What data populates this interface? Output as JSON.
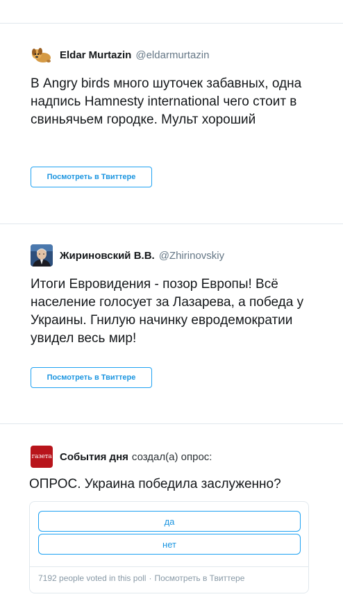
{
  "tweets": [
    {
      "name": "Eldar Murtazin",
      "handle": "@eldarmurtazin",
      "text": "В Angry birds много шуточек забавных, одна надпись Hamnesty international чего стоит в свиньячьем городке. Мульт хороший",
      "button": "Посмотреть в Твиттере",
      "avatar_icon": "cartoon-dog-avatar"
    },
    {
      "name": "Жириновский В.В.",
      "handle": "@Zhirinovskiy",
      "text": "Итоги Евровидения - позор Европы! Всё население голосует за Лазарева, а победа у Украины. Гнилую начинку еврoдемократии увидел весь мир!",
      "button": "Посмотреть в Твиттере",
      "avatar_icon": "portrait-avatar"
    }
  ],
  "poll": {
    "name": "События дня",
    "action": "создал(а) опрос:",
    "avatar_text": "газета",
    "question": "ОПРОС. Украина победила заслуженно?",
    "options": [
      "да",
      "нет"
    ],
    "votes_text": "7192 people voted in this poll",
    "separator": "·",
    "view_link": "Посмотреть в Твиттере"
  },
  "colors": {
    "accent": "#1da1f2",
    "link": "#1b95e0",
    "border": "#e1e8ed",
    "secondary": "#657786",
    "avatar_red": "#b8141b"
  }
}
